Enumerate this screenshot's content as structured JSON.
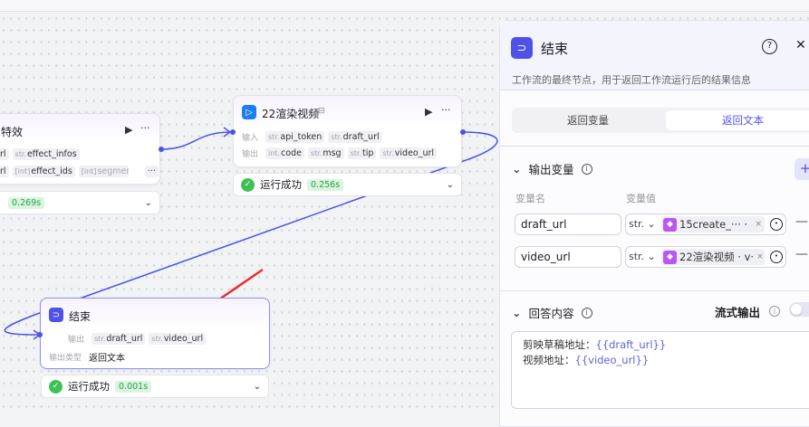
{
  "nodes": {
    "effects": {
      "title": "特效",
      "row1_prefix": "rl",
      "row1_tags": [
        {
          "type": "str.",
          "name": "effect_infos"
        }
      ],
      "row2_prefix": "rl",
      "row2_tags": [
        {
          "type": "[int]",
          "name": "effect_ids"
        },
        {
          "type": "[int]",
          "name": "segment_ids"
        }
      ],
      "more": "···",
      "time": "0.269s"
    },
    "render": {
      "title": "22渲染视频",
      "input_label": "输入",
      "inputs": [
        {
          "type": "str.",
          "name": "api_token"
        },
        {
          "type": "str.",
          "name": "draft_url"
        }
      ],
      "output_label": "输出",
      "outputs": [
        {
          "type": "int.",
          "name": "code"
        },
        {
          "type": "str.",
          "name": "msg"
        },
        {
          "type": "str.",
          "name": "tip"
        },
        {
          "type": "str.",
          "name": "video_url"
        }
      ],
      "status": "运行成功",
      "time": "0.256s"
    },
    "end": {
      "title": "结束",
      "output_label": "输出",
      "outputs": [
        {
          "type": "str.",
          "name": "draft_url"
        },
        {
          "type": "str.",
          "name": "video_url"
        }
      ],
      "output_type_label": "输出类型",
      "output_type": "返回文本",
      "status": "运行成功",
      "time": "0.001s"
    }
  },
  "panel": {
    "title": "结束",
    "help": "?",
    "close": "✕",
    "description": "工作流的最终节点，用于返回工作流运行后的结果信息",
    "tabs": [
      "返回变量",
      "返回文本"
    ],
    "output_section": "输出变量",
    "add": "+",
    "col_name": "变量名",
    "col_value": "变量值",
    "vars": [
      {
        "name": "draft_url",
        "type": "str.",
        "ref": "15create_···  ·"
      },
      {
        "name": "video_url",
        "type": "str.",
        "ref": "22渲染视频 · v·"
      }
    ],
    "answer_section": "回答内容",
    "stream_label": "流式输出",
    "answer_line1_text": "剪映草稿地址：",
    "answer_line1_var": "{{draft_url}}",
    "answer_line2_text": "视频地址：",
    "answer_line2_var": "{{video_url}}"
  },
  "colors": {
    "accent": "#4d53e8",
    "success": "#3ec254",
    "plugin": "#b957f2"
  }
}
